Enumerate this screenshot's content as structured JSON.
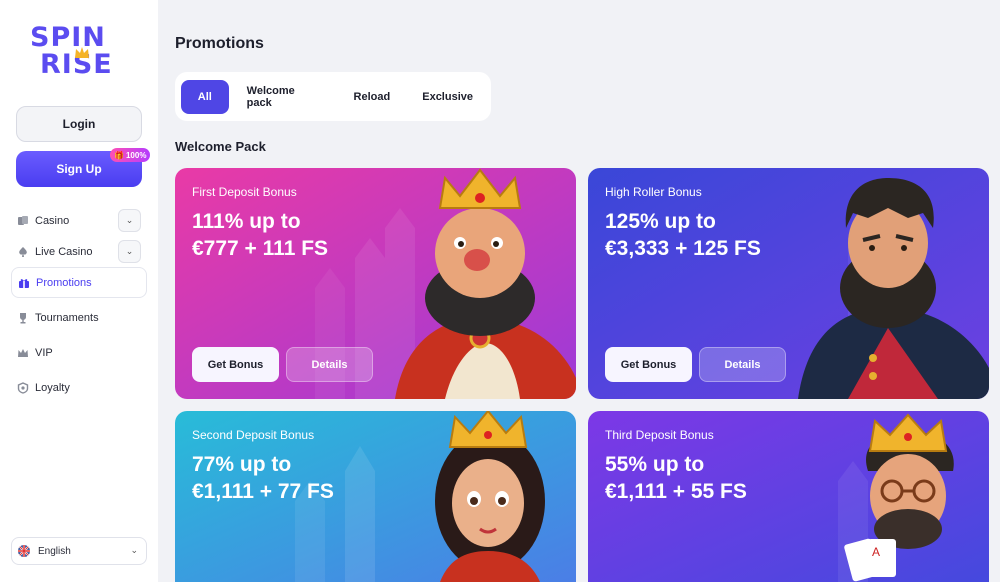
{
  "brand": {
    "line1": "SPIN",
    "line2": "RISE",
    "color": "#5b4cf0"
  },
  "auth": {
    "login_label": "Login",
    "signup_label": "Sign Up",
    "signup_badge": "100%"
  },
  "nav": {
    "items": [
      {
        "label": "Casino",
        "icon": "cards-icon",
        "expandable": true
      },
      {
        "label": "Live Casino",
        "icon": "spade-icon",
        "expandable": true
      },
      {
        "label": "Promotions",
        "icon": "gift-icon",
        "active": true
      },
      {
        "label": "Tournaments",
        "icon": "trophy-icon"
      },
      {
        "label": "VIP",
        "icon": "crown-icon"
      },
      {
        "label": "Loyalty",
        "icon": "badge-icon"
      }
    ]
  },
  "language": {
    "label": "English",
    "flag": "uk-flag-icon"
  },
  "page": {
    "title": "Promotions",
    "section_title": "Welcome Pack"
  },
  "tabs": [
    {
      "label": "All",
      "active": true
    },
    {
      "label": "Welcome pack"
    },
    {
      "label": "Reload"
    },
    {
      "label": "Exclusive"
    }
  ],
  "cards": [
    {
      "title": "First Deposit Bonus",
      "line1": "111% up to",
      "line2": "€777 + 111 FS",
      "get_label": "Get Bonus",
      "details_label": "Details",
      "bg": [
        "#e83aa8",
        "#a83ad6"
      ]
    },
    {
      "title": "High Roller Bonus",
      "line1": "125% up to",
      "line2": "€3,333 + 125 FS",
      "get_label": "Get Bonus",
      "details_label": "Details",
      "bg": [
        "#3b46d9",
        "#6a3ee0"
      ]
    },
    {
      "title": "Second Deposit Bonus",
      "line1": "77% up to",
      "line2": "€1,111 + 77 FS",
      "bg": [
        "#2bb8d8",
        "#4a7fe8"
      ]
    },
    {
      "title": "Third Deposit Bonus",
      "line1": "55% up to",
      "line2": "€1,111 + 55 FS",
      "bg": [
        "#7a3ae8",
        "#4a48e0"
      ]
    }
  ]
}
